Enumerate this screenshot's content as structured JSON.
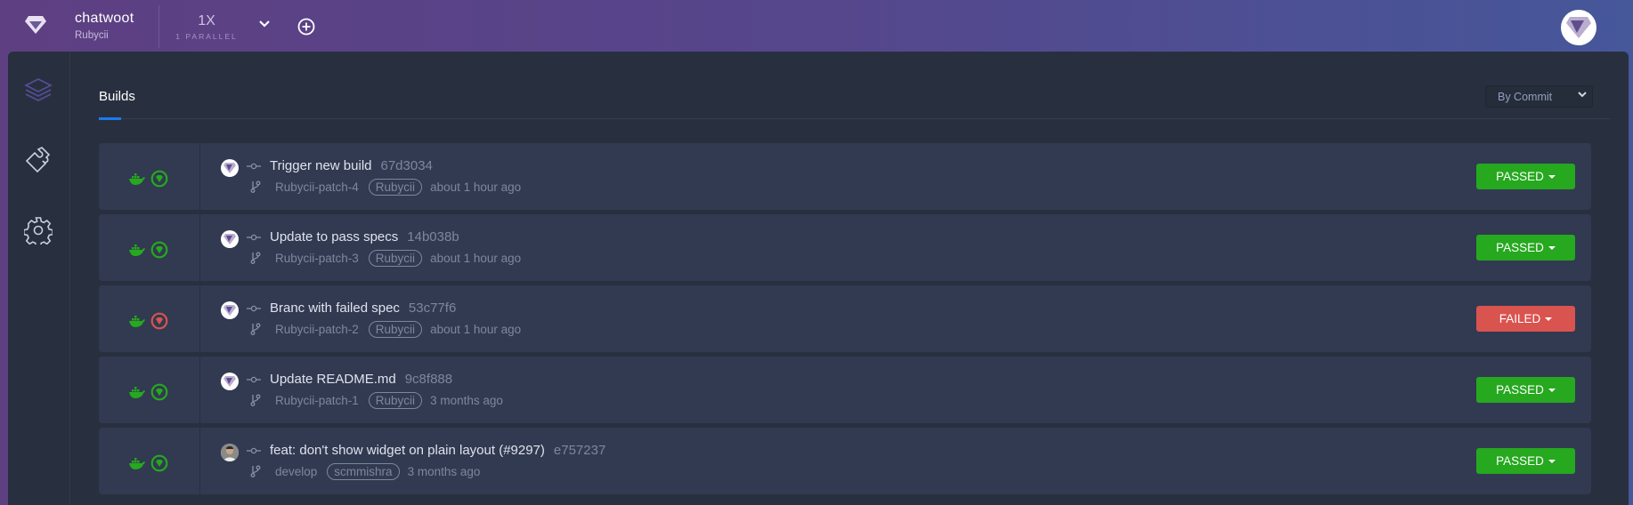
{
  "header": {
    "org_name": "chatwoot",
    "org_sub": "Rubycii",
    "parallel_value": "1X",
    "parallel_label": "1 PARALLEL",
    "logo_icon": "diamond-logo",
    "dropdown_icon": "chevron-down-icon",
    "add_icon": "plus-circle-icon"
  },
  "sidebar": {
    "items": [
      {
        "icon": "layers-icon",
        "name": "builds"
      },
      {
        "icon": "puzzle-icon",
        "name": "integrations"
      },
      {
        "icon": "gear-icon",
        "name": "settings"
      }
    ]
  },
  "main": {
    "tab": "Builds",
    "sort_select": "By Commit"
  },
  "colors": {
    "passed": "#26a81f",
    "failed": "#d9534f",
    "accent": "#1a7cf0"
  },
  "builds": [
    {
      "title": "Trigger new build",
      "sha": "67d3034",
      "branch": "Rubycii-patch-4",
      "author": "Rubycii",
      "time": "about 1 hour ago",
      "status": "PASSED",
      "state": "passed",
      "avatar": "logo"
    },
    {
      "title": "Update to pass specs",
      "sha": "14b038b",
      "branch": "Rubycii-patch-3",
      "author": "Rubycii",
      "time": "about 1 hour ago",
      "status": "PASSED",
      "state": "passed",
      "avatar": "logo"
    },
    {
      "title": "Branc with failed spec",
      "sha": "53c77f6",
      "branch": "Rubycii-patch-2",
      "author": "Rubycii",
      "time": "about 1 hour ago",
      "status": "FAILED",
      "state": "failed",
      "avatar": "logo"
    },
    {
      "title": "Update README.md",
      "sha": "9c8f888",
      "branch": "Rubycii-patch-1",
      "author": "Rubycii",
      "time": "3 months ago",
      "status": "PASSED",
      "state": "passed",
      "avatar": "logo"
    },
    {
      "title": "feat: don't show widget on plain layout (#9297)",
      "sha": "e757237",
      "branch": "develop",
      "author": "scmmishra",
      "time": "3 months ago",
      "status": "PASSED",
      "state": "passed",
      "avatar": "photo"
    }
  ]
}
